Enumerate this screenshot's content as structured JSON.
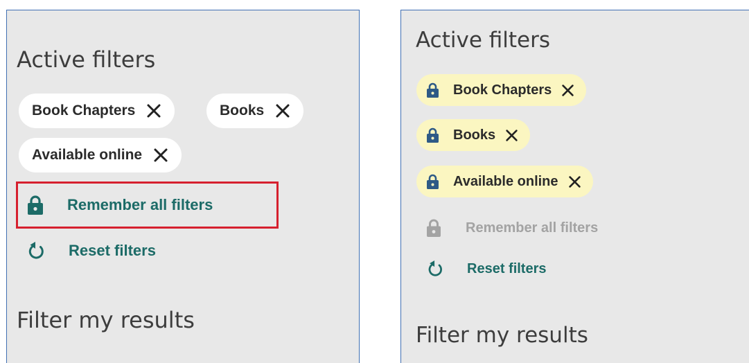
{
  "colors": {
    "accent": "#1c6b67",
    "panel_background": "#e8e8e8",
    "locked_chip_background": "#fbf6c1",
    "disabled_text": "#a3a3a3",
    "highlight_border": "#d6202e"
  },
  "left_panel": {
    "active_filters_heading": "Active filters",
    "chips": [
      {
        "label": "Book Chapters",
        "icon": "close-icon"
      },
      {
        "label": "Books",
        "icon": "close-icon"
      },
      {
        "label": "Available online",
        "icon": "close-icon"
      }
    ],
    "remember_all_filters": {
      "label": "Remember all filters",
      "icon": "lock-icon",
      "highlighted": true
    },
    "reset_filters": {
      "label": "Reset filters",
      "icon": "reset-icon"
    },
    "filter_results_heading": "Filter my results"
  },
  "right_panel": {
    "active_filters_heading": "Active filters",
    "chips": [
      {
        "label": "Book Chapters",
        "icon": "close-icon",
        "locked": true
      },
      {
        "label": "Books",
        "icon": "close-icon",
        "locked": true
      },
      {
        "label": "Available online",
        "icon": "close-icon",
        "locked": true
      }
    ],
    "remember_all_filters": {
      "label": "Remember all filters",
      "icon": "lock-icon",
      "disabled": true
    },
    "reset_filters": {
      "label": "Reset filters",
      "icon": "reset-icon"
    },
    "filter_results_heading": "Filter my results"
  }
}
